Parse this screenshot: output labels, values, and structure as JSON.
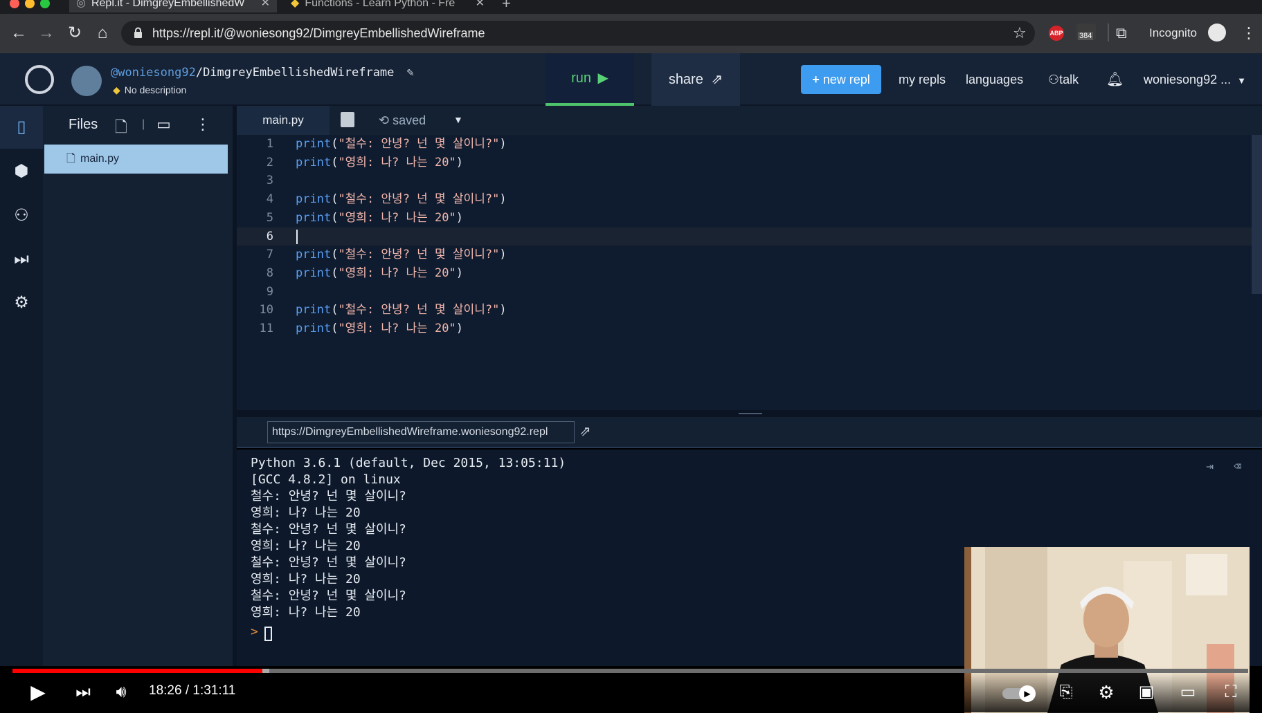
{
  "browser": {
    "tabs": [
      {
        "label": "Repl.it - DimgreyEmbellishedW",
        "active": true
      },
      {
        "label": "Functions - Learn Python - Fre",
        "active": false
      }
    ],
    "new_tab_label": "+",
    "url": "https://repl.it/@woniesong92/DimgreyEmbellishedWireframe",
    "incognito_label": "Incognito",
    "extension_badge": "384",
    "abp_label": "ABP"
  },
  "header": {
    "username": "@woniesong92",
    "repl_name": "/DimgreyEmbellishedWireframe",
    "description": "No description",
    "run_label": "run",
    "share_label": "share",
    "new_repl_label": "new repl",
    "my_repls_label": "my repls",
    "languages_label": "languages",
    "talk_label": "talk",
    "account_label": "woniesong92 ..."
  },
  "files": {
    "title": "Files",
    "items": [
      {
        "name": "main.py",
        "selected": true
      }
    ]
  },
  "editor": {
    "tab_label": "main.py",
    "status": "saved",
    "current_line": 6,
    "lines": [
      {
        "n": "1",
        "fn": "print",
        "arg": "\"철수: 안녕? 넌 몇 살이니?\""
      },
      {
        "n": "2",
        "fn": "print",
        "arg": "\"영희: 나? 나는 20\""
      },
      {
        "n": "3",
        "fn": "",
        "arg": ""
      },
      {
        "n": "4",
        "fn": "print",
        "arg": "\"철수: 안녕? 넌 몇 살이니?\""
      },
      {
        "n": "5",
        "fn": "print",
        "arg": "\"영희: 나? 나는 20\""
      },
      {
        "n": "6",
        "fn": "",
        "arg": ""
      },
      {
        "n": "7",
        "fn": "print",
        "arg": "\"철수: 안녕? 넌 몇 살이니?\""
      },
      {
        "n": "8",
        "fn": "print",
        "arg": "\"영희: 나? 나는 20\""
      },
      {
        "n": "9",
        "fn": "",
        "arg": ""
      },
      {
        "n": "10",
        "fn": "print",
        "arg": "\"철수: 안녕? 넌 몇 살이니?\""
      },
      {
        "n": "11",
        "fn": "print",
        "arg": "\"영희: 나? 나는 20\""
      }
    ]
  },
  "console": {
    "web_url": "https://DimgreyEmbellishedWireframe.woniesong92.repl",
    "lines": [
      "Python 3.6.1 (default, Dec 2015, 13:05:11)",
      "[GCC 4.8.2] on linux",
      "철수: 안녕? 넌 몇 살이니?",
      "영희: 나? 나는 20",
      "철수: 안녕? 넌 몇 살이니?",
      "영희: 나? 나는 20",
      "철수: 안녕? 넌 몇 살이니?",
      "영희: 나? 나는 20",
      "철수: 안녕? 넌 몇 살이니?",
      "영희: 나? 나는 20"
    ],
    "prompt": ">"
  },
  "video": {
    "time": "18:26 / 1:31:11",
    "progress_fraction": 0.2025
  },
  "colors": {
    "run_accent": "#58d176",
    "new_repl": "#3d9cf0",
    "progress": "#ff0000",
    "keyword": "#5aa0f5",
    "string": "#f3b8ae"
  }
}
